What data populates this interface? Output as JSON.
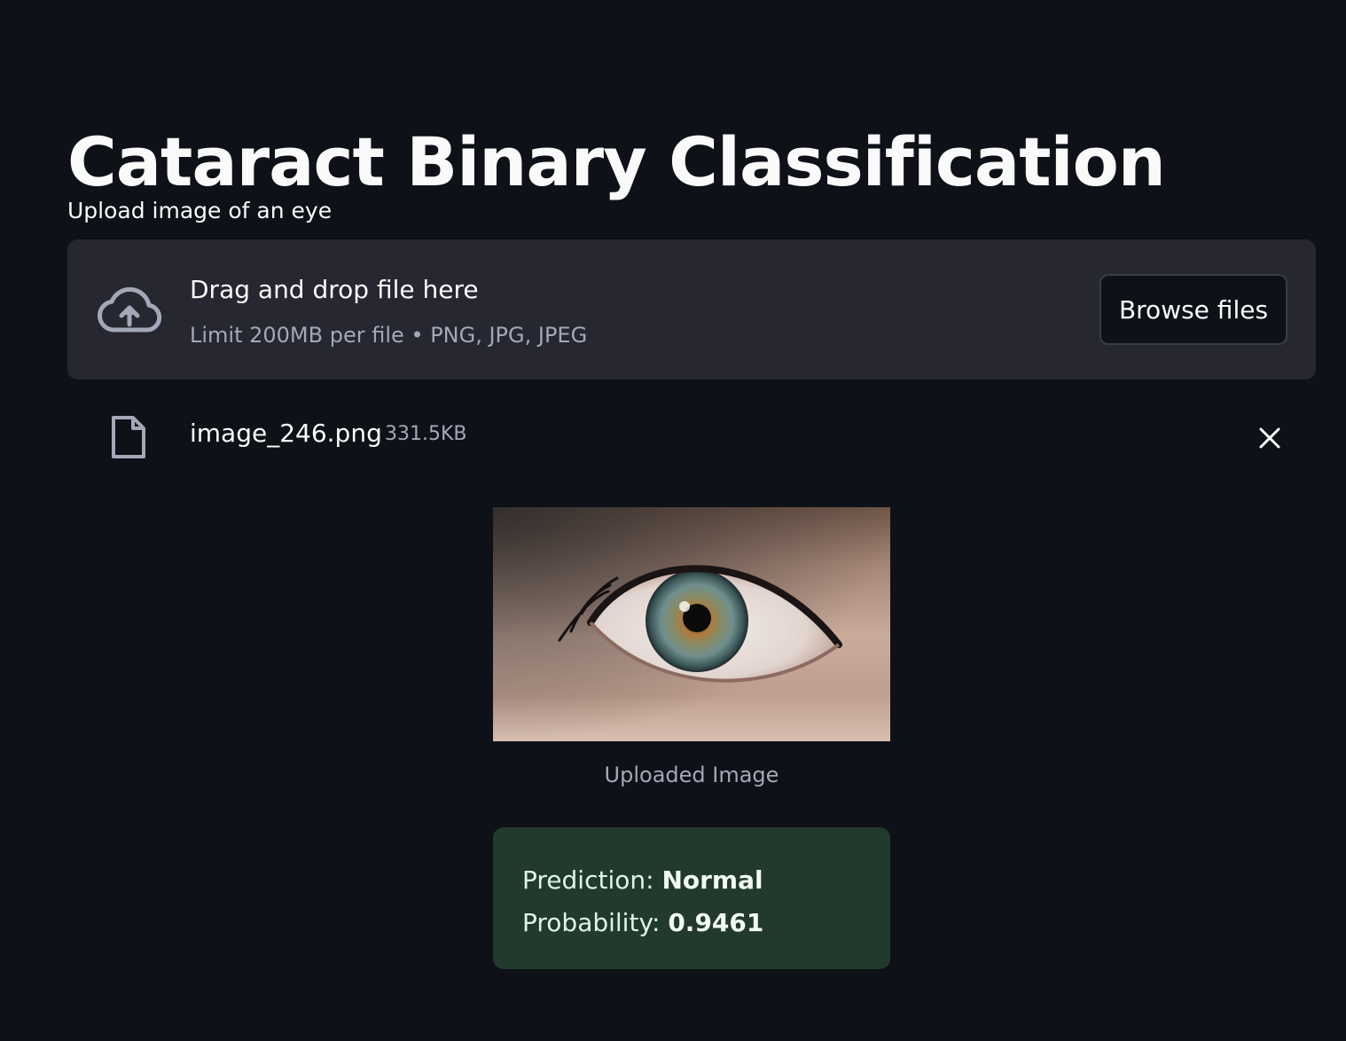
{
  "page": {
    "title": "Cataract Binary Classification"
  },
  "uploader": {
    "label": "Upload image of an eye",
    "drop_text": "Drag and drop file here",
    "limit_text": "Limit 200MB per file • PNG, JPG, JPEG",
    "browse_label": "Browse files",
    "icon": "cloud-upload-icon"
  },
  "uploaded_file": {
    "name": "image_246.png",
    "size": "331.5KB",
    "icon": "file-icon",
    "remove_icon": "close-icon"
  },
  "image": {
    "caption": "Uploaded Image"
  },
  "result": {
    "prediction_label": "Prediction:",
    "prediction_value": "Normal",
    "probability_label": "Probability:",
    "probability_value": "0.9461"
  },
  "colors": {
    "background": "#0e1117",
    "dropzone": "#262730",
    "success_box": "#213a2c",
    "text": "#fafafa",
    "muted_text": "#a3a8b8"
  }
}
